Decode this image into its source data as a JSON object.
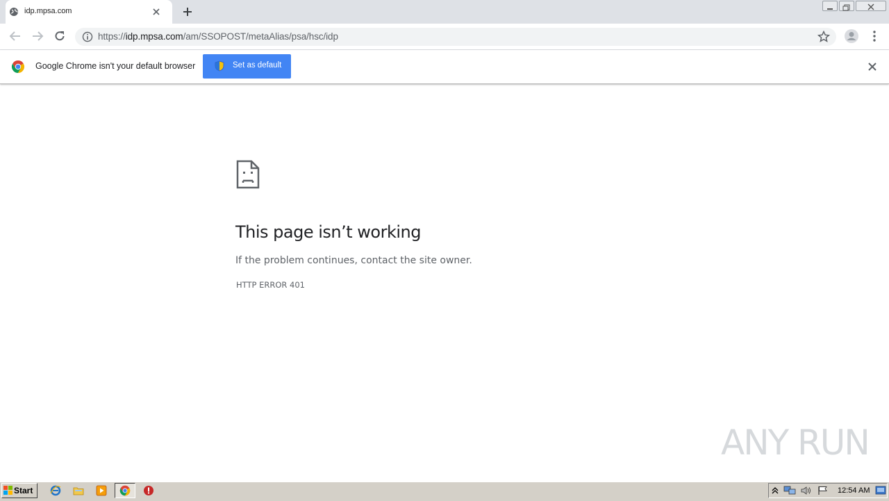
{
  "tab": {
    "title": "idp.mpsa.com"
  },
  "toolbar": {
    "url_scheme": "https://",
    "url_host": "idp.mpsa.com",
    "url_path": "/am/SSOPOST/metaAlias/psa/hsc/idp"
  },
  "infobar": {
    "message": "Google Chrome isn't your default browser",
    "button_label": "Set as default"
  },
  "error": {
    "title": "This page isn’t working",
    "message": "If the problem continues, contact the site owner.",
    "code": "HTTP ERROR 401"
  },
  "watermark": "ANY RUN",
  "taskbar": {
    "start_label": "Start",
    "clock": "12:54 AM"
  },
  "icons": {
    "tab_favicon": "globe-icon",
    "back": "arrow-left-icon",
    "forward": "arrow-right-icon",
    "reload": "reload-icon",
    "site_info": "info-icon",
    "bookmark": "star-icon",
    "profile": "avatar-icon",
    "menu": "kebab-menu-icon",
    "chrome_logo": "chrome-logo-icon",
    "uac_shield": "shield-icon",
    "error_page": "sad-page-icon"
  },
  "colors": {
    "tabstrip": "#dee1e6",
    "primary_button": "#4285f4",
    "taskbar": "#d4d0c8"
  }
}
